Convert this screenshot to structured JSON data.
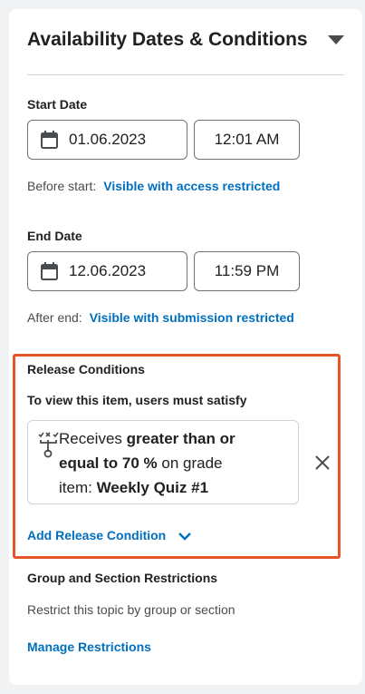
{
  "panel": {
    "title": "Availability Dates & Conditions"
  },
  "start": {
    "label": "Start Date",
    "date": "01.06.2023",
    "time": "12:01 AM",
    "before_prefix": "Before start:",
    "before_link": "Visible with access restricted"
  },
  "end": {
    "label": "End Date",
    "date": "12.06.2023",
    "time": "11:59 PM",
    "after_prefix": "After end:",
    "after_link": "Visible with submission restricted"
  },
  "release": {
    "heading": "Release Conditions",
    "subheading": "To view this item, users must satisfy",
    "condition": {
      "part1": "Receives ",
      "bold1": "greater than or equal to 70 %",
      "part2": " on grade item: ",
      "bold2": "Weekly Quiz #1"
    },
    "add_label": "Add Release Condition"
  },
  "restrictions": {
    "heading": "Group and Section Restrictions",
    "description": "Restrict this topic by group or section",
    "manage_link": "Manage Restrictions"
  },
  "colors": {
    "link": "#006fbf",
    "highlight": "#e5552a"
  }
}
